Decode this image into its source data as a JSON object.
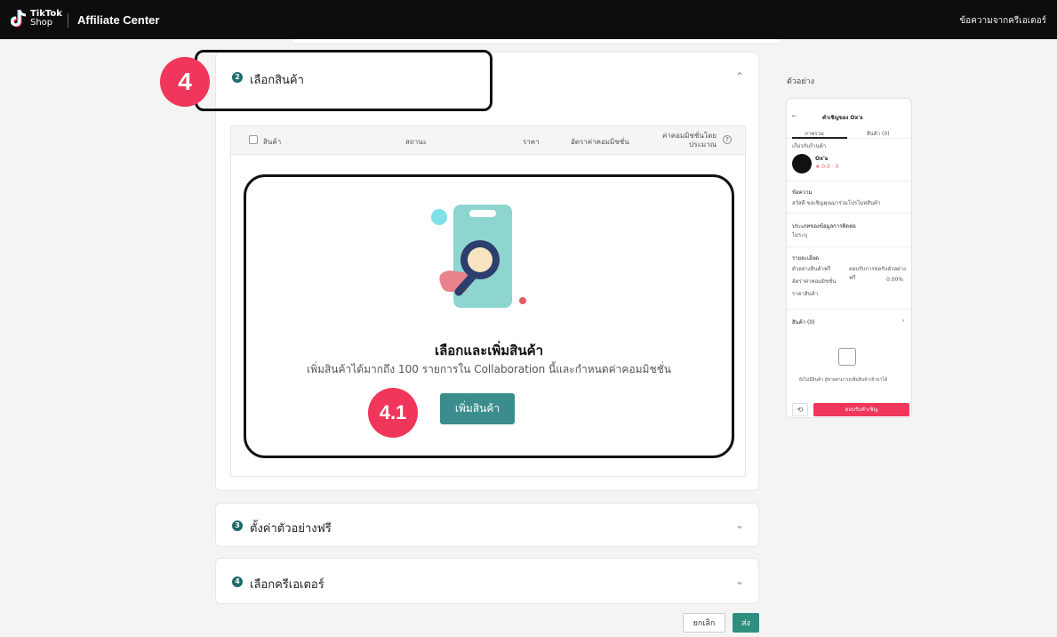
{
  "topbar": {
    "logo_line1": "TikTok",
    "logo_line2": "Shop",
    "app_title": "Affiliate Center",
    "right_link": "ข้อความจากครีเอเตอร์"
  },
  "sections": [
    {
      "num": "2",
      "title": "เลือกสินค้า",
      "chevron": "⌃"
    },
    {
      "num": "3",
      "title": "ตั้งค่าตัวอย่างฟรี",
      "chevron": "⌄"
    },
    {
      "num": "4",
      "title": "เลือกครีเอเตอร์",
      "chevron": "⌄"
    }
  ],
  "table": {
    "headers": [
      "สินค้า",
      "สถานะ",
      "ราคา",
      "อัตราค่าคอมมิชชั่น",
      "ค่าคอมมิชชั่นโดยประมาณ"
    ]
  },
  "empty_state": {
    "title": "เลือกและเพิ่มสินค้า",
    "description": "เพิ่มสินค้าได้มากถึง 100 รายการใน Collaboration นี้และกำหนดค่าคอมมิชชั่น",
    "button": "เพิ่มสินค้า"
  },
  "annotations": {
    "step4": "4",
    "step41": "4.1"
  },
  "footer": {
    "cancel": "ยกเลิก",
    "send": "ส่ง"
  },
  "preview": {
    "label": "ตัวอย่าง",
    "header": "คำเชิญของ Ox's",
    "tab1": "ภาพรวม",
    "tab2": "สินค้า (0)",
    "shop_label": "เกี่ยวกับร้านค้า",
    "shop_name": "Ox's",
    "message_label": "ข้อความ",
    "message_text": "สวัสดี ขอเชิญคุณมาร่วมโปรโมทสินค้า",
    "contact_label": "ประเภทของข้อมูลการติดต่อ",
    "contact_value": "ไม่ระบุ",
    "details_label": "รายละเอียด",
    "d1_label": "ตัวอย่างสินค้าฟรี",
    "d1_value": "ตอบรับการขอรับตัวอย่างฟรี",
    "d2_label": "อัตราค่าคอมมิชชั่น",
    "d2_value": "0.00%",
    "d3_label": "ราคาสินค้า",
    "products_label": "สินค้า (0)",
    "empty_note": "ยังไม่มีสินค้า ผู้ขายสามารถเพิ่มสินค้าเข้ามาได้",
    "accept_button": "ตอบรับคำเชิญ"
  }
}
